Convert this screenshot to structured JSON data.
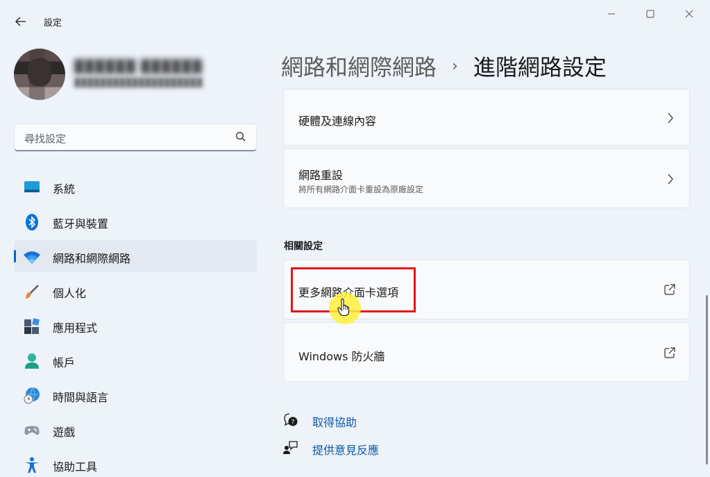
{
  "window": {
    "title": "設定",
    "controls": [
      "minimize-icon",
      "maximize-icon",
      "close-icon"
    ]
  },
  "profile": {
    "name": "██████ ██████",
    "email": "████████████████████"
  },
  "search": {
    "placeholder": "尋找設定",
    "icon": "search-icon"
  },
  "sidebar": {
    "items": [
      {
        "label": "系統",
        "icon": "monitor-icon",
        "active": false
      },
      {
        "label": "藍牙與裝置",
        "icon": "bluetooth-icon",
        "active": false
      },
      {
        "label": "網路和網際網路",
        "icon": "wifi-icon",
        "active": true
      },
      {
        "label": "個人化",
        "icon": "brush-icon",
        "active": false
      },
      {
        "label": "應用程式",
        "icon": "apps-icon",
        "active": false
      },
      {
        "label": "帳戶",
        "icon": "person-icon",
        "active": false
      },
      {
        "label": "時間與語言",
        "icon": "globe-clock-icon",
        "active": false
      },
      {
        "label": "遊戲",
        "icon": "gamepad-icon",
        "active": false
      },
      {
        "label": "協助工具",
        "icon": "accessibility-icon",
        "active": false
      }
    ]
  },
  "header": {
    "parent": "網路和網際網路",
    "separator": "›",
    "current": "進階網路設定"
  },
  "cards": {
    "hardware": {
      "title": "硬體及連線內容"
    },
    "reset": {
      "title": "網路重設",
      "subtitle": "將所有網路介面卡重設為原廠設定"
    },
    "related_title": "相關設定",
    "adapter_options": {
      "title": "更多網路介面卡選項"
    },
    "firewall": {
      "title": "Windows 防火牆"
    }
  },
  "help": {
    "get_help": "取得協助",
    "feedback": "提供意見反應"
  },
  "colors": {
    "accent": "#0067c0",
    "highlight_box": "#e3121b",
    "cursor_glow": "#fff03c",
    "link": "#0a5aa8"
  }
}
